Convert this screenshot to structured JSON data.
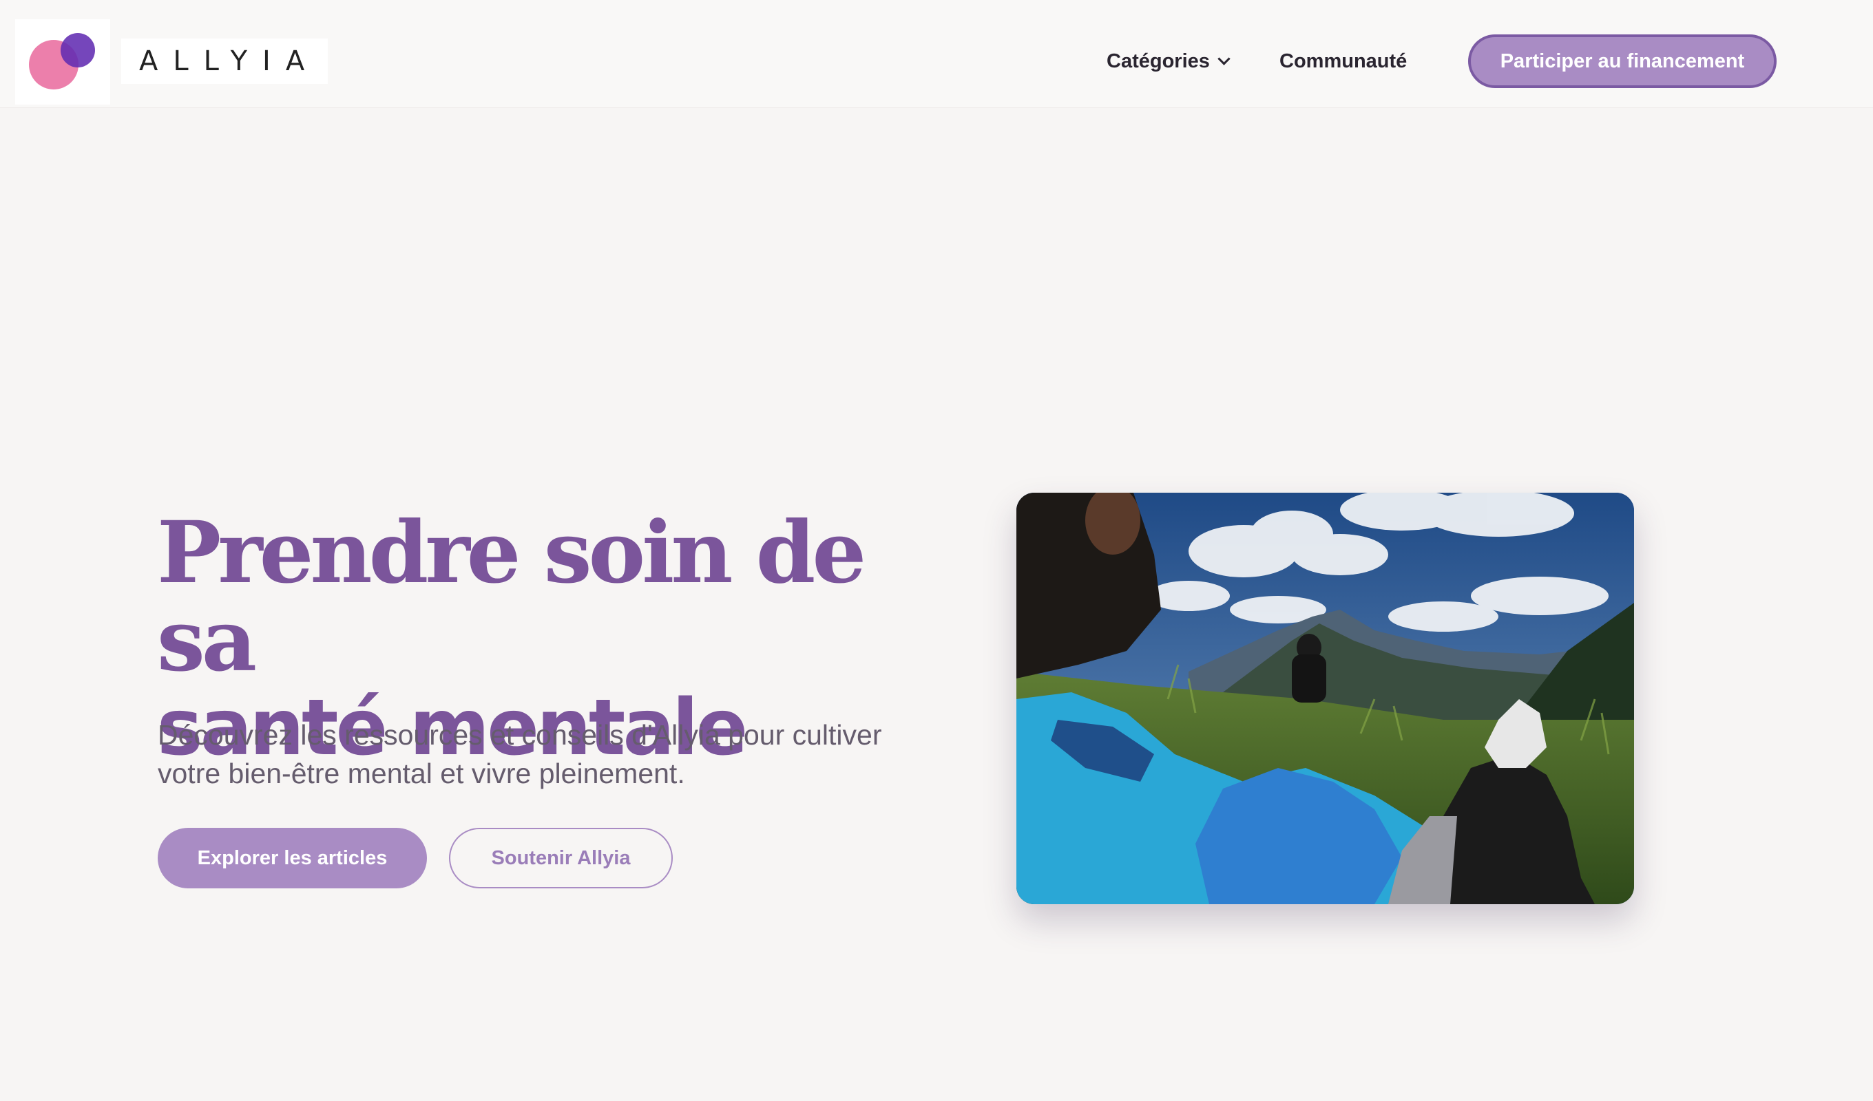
{
  "header": {
    "brand": "ALLYIA",
    "nav": {
      "categories_label": "Catégories",
      "community_label": "Communauté"
    },
    "cta_label": "Participer au financement"
  },
  "hero": {
    "title_line1": "Prendre soin de sa",
    "title_line2": "santé mentale",
    "description": "Découvrez les ressources et conseils d'Allyia pour cultiver votre bien-être mental et vivre pleinement.",
    "primary_button": "Explorer les articles",
    "secondary_button": "Soutenir Allyia"
  },
  "colors": {
    "accent_purple": "#7b559b",
    "button_purple": "#a98cc4",
    "logo_pink": "#ec7fab",
    "logo_violet": "#622cb2"
  },
  "icons": {
    "categories_dropdown": "chevron-down-icon"
  }
}
